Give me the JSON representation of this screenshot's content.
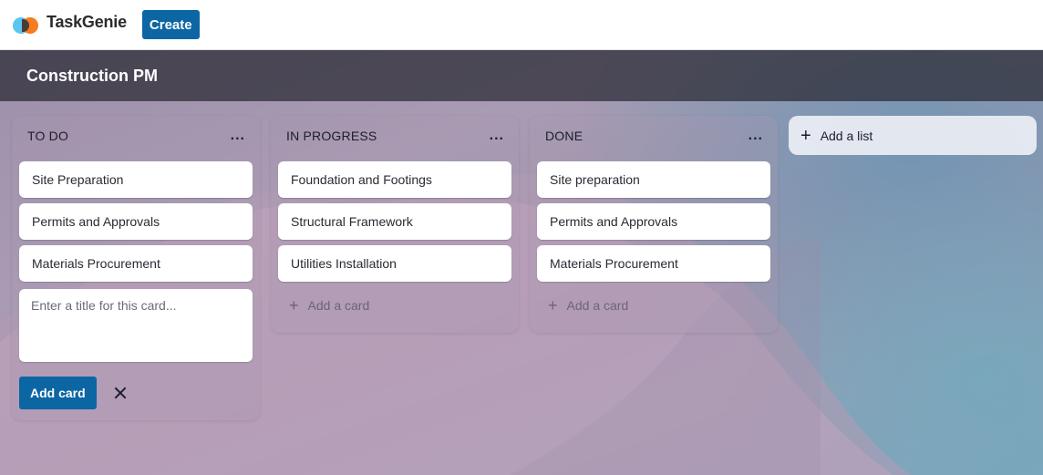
{
  "app": {
    "name": "TaskGenie",
    "logo_icon": "taskgenie-logo-icon",
    "create_label": "Create"
  },
  "board": {
    "title": "Construction PM",
    "add_list_label": "Add a list"
  },
  "lists": [
    {
      "title": "TO DO",
      "menu_label": "...",
      "cards": [
        "Site Preparation",
        "Permits and Approvals",
        "Materials Procurement"
      ],
      "composer_placeholder": "Enter a title for this card...",
      "add_card_button_label": "Add card"
    },
    {
      "title": "IN PROGRESS",
      "menu_label": "...",
      "cards": [
        "Foundation and Footings",
        "Structural Framework",
        "Utilities Installation"
      ],
      "add_card_label": "Add a card"
    },
    {
      "title": "DONE",
      "menu_label": "...",
      "cards": [
        "Site preparation",
        "Permits and Approvals",
        "Materials Procurement"
      ],
      "add_card_label": "Add a card"
    }
  ],
  "colors": {
    "primary_button": "#0c66a4",
    "board_header": "#3d3b46"
  }
}
